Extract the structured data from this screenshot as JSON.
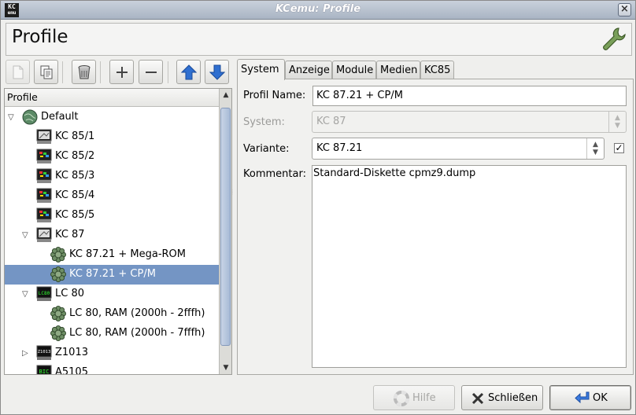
{
  "window": {
    "title": "KCemu: Profile",
    "app_icon_text_top": "KC",
    "app_icon_text_bottom": "emu",
    "close_symbol": "×"
  },
  "header": {
    "title": "Profile",
    "icon": "wrench-icon"
  },
  "toolbar": {
    "buttons": [
      {
        "name": "new-profile-button",
        "icon": "new-document-icon",
        "enabled": false
      },
      {
        "name": "copy-profile-button",
        "icon": "copy-icon",
        "enabled": true
      },
      {
        "name": "delete-profile-button",
        "icon": "trash-icon",
        "enabled": true
      },
      {
        "name": "expand-all-button",
        "icon": "plus-icon",
        "enabled": true
      },
      {
        "name": "collapse-all-button",
        "icon": "minus-icon",
        "enabled": true
      },
      {
        "name": "move-up-button",
        "icon": "arrow-up-icon",
        "enabled": true
      },
      {
        "name": "move-down-button",
        "icon": "arrow-down-icon",
        "enabled": true
      }
    ]
  },
  "tree": {
    "header": "Profile",
    "rows": [
      {
        "label": "Default",
        "level": 0,
        "expander": "open",
        "icon": "globe-icon",
        "selected": false
      },
      {
        "label": "KC 85/1",
        "level": 1,
        "expander": "",
        "icon": "computer-icon",
        "selected": false
      },
      {
        "label": "KC 85/2",
        "level": 1,
        "expander": "",
        "icon": "computer-color-icon",
        "selected": false
      },
      {
        "label": "KC 85/3",
        "level": 1,
        "expander": "",
        "icon": "computer-color-icon",
        "selected": false
      },
      {
        "label": "KC 85/4",
        "level": 1,
        "expander": "",
        "icon": "computer-color-icon",
        "selected": false
      },
      {
        "label": "KC 85/5",
        "level": 1,
        "expander": "",
        "icon": "computer-color-icon",
        "selected": false
      },
      {
        "label": "KC 87",
        "level": 1,
        "expander": "open",
        "icon": "computer-icon",
        "selected": false
      },
      {
        "label": "KC 87.21 + Mega-ROM",
        "level": 2,
        "expander": "",
        "icon": "flower-icon",
        "selected": false
      },
      {
        "label": "KC 87.21 + CP/M",
        "level": 2,
        "expander": "",
        "icon": "flower-icon",
        "selected": true
      },
      {
        "label": "LC 80",
        "level": 1,
        "expander": "open",
        "icon": "lc80-icon",
        "selected": false
      },
      {
        "label": "LC 80, RAM (2000h - 2fffh)",
        "level": 2,
        "expander": "",
        "icon": "flower-icon",
        "selected": false
      },
      {
        "label": "LC 80, RAM (2000h - 7fffh)",
        "level": 2,
        "expander": "",
        "icon": "flower-icon",
        "selected": false
      },
      {
        "label": "Z1013",
        "level": 1,
        "expander": "closed",
        "icon": "z1013-icon",
        "selected": false
      },
      {
        "label": "A5105",
        "level": 1,
        "expander": "",
        "icon": "bic-icon",
        "selected": false
      }
    ],
    "z1013_icon_text": "Z1013",
    "bic_icon_text": "BIC"
  },
  "tabs": [
    {
      "label": "System",
      "active": true
    },
    {
      "label": "Anzeige",
      "active": false
    },
    {
      "label": "Module",
      "active": false
    },
    {
      "label": "Medien",
      "active": false
    },
    {
      "label": "KC85",
      "active": false
    }
  ],
  "form": {
    "profile_name_label": "Profil Name:",
    "profile_name_value": "KC 87.21 + CP/M",
    "system_label": "System:",
    "system_value": "KC 87",
    "variant_label": "Variante:",
    "variant_value": "KC 87.21",
    "variant_checked": true,
    "comment_label": "Kommentar:",
    "comment_value": "Standard-Diskette cpmz9.dump"
  },
  "buttons": {
    "help_label": "Hilfe",
    "close_label": "Schließen",
    "ok_label": "OK"
  },
  "colors": {
    "selection": "#7495c4",
    "titlebar": "#a9b4c3",
    "arrow_blue": "#2f6fd0"
  }
}
